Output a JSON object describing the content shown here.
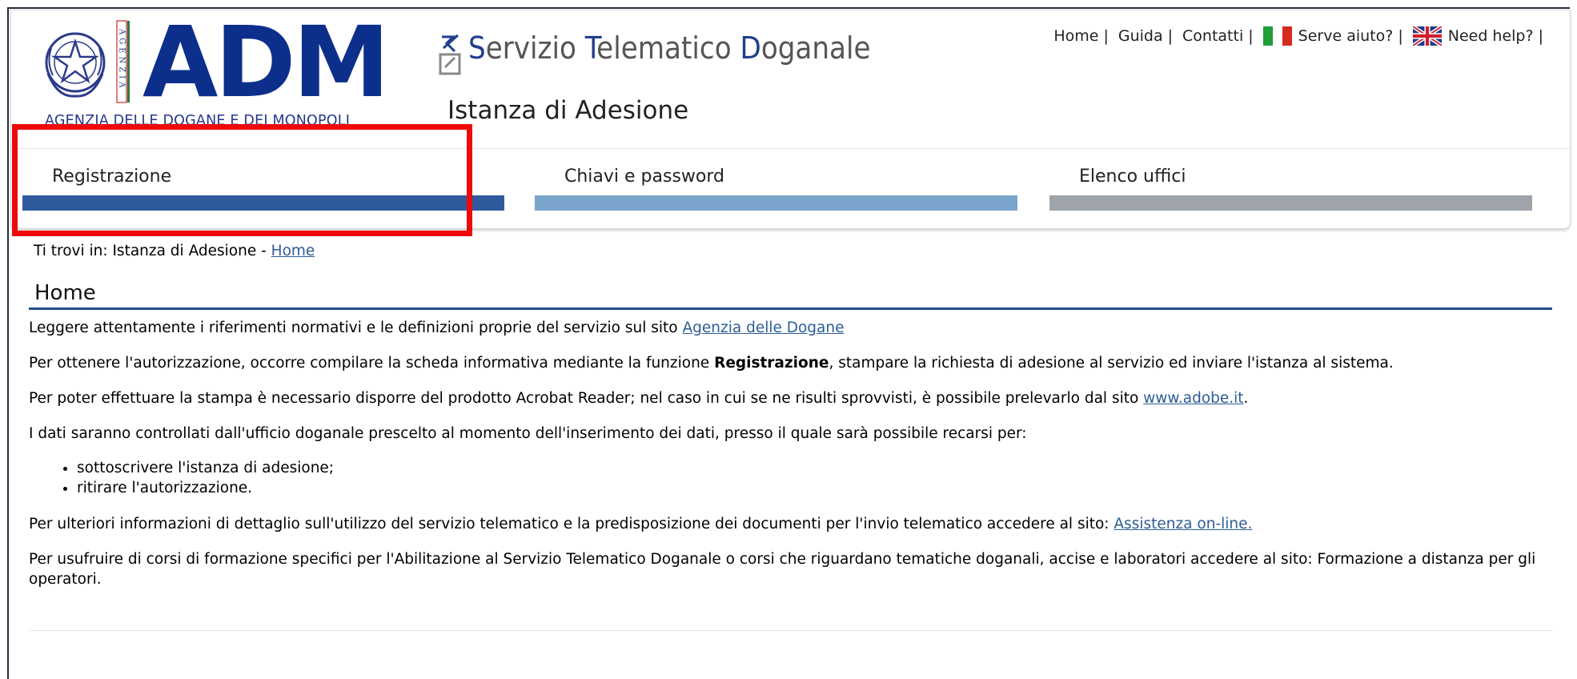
{
  "logo": {
    "acronym": "ADM",
    "vertical_text": "AGENZIA",
    "caption": "AGENZIA DELLE DOGANE E DEI MONOPOLI",
    "brand_color": "#0c2f8c"
  },
  "service": {
    "title_parts": [
      {
        "cap": "S",
        "rest": "ervizio "
      },
      {
        "cap": "T",
        "rest": "elematico "
      },
      {
        "cap": "D",
        "rest": "oganale"
      }
    ],
    "subtitle": "Istanza di Adesione"
  },
  "top_links": {
    "home": "Home",
    "guida": "Guida",
    "contatti": "Contatti",
    "serve_aiuto": "Serve aiuto?",
    "need_help": "Need help?",
    "separator": "|"
  },
  "tabs": [
    {
      "label": "Registrazione",
      "color": "#2f5a9e"
    },
    {
      "label": "Chiavi e password",
      "color": "#7aa4cc"
    },
    {
      "label": "Elenco uffici",
      "color": "#9ea4aa"
    }
  ],
  "breadcrumb": {
    "prefix": "Ti trovi in: Istanza di Adesione - ",
    "link": "Home"
  },
  "page": {
    "title": "Home",
    "p1_text": "Leggere attentamente i riferimenti normativi e le definizioni proprie del servizio sul sito ",
    "p1_link": "Agenzia delle Dogane",
    "p2_pre": "Per ottenere l'autorizzazione, occorre compilare la scheda informativa mediante la funzione ",
    "p2_bold": "Registrazione",
    "p2_post": ", stampare la richiesta di adesione al servizio ed inviare l'istanza al sistema.",
    "p3_text": "Per poter effettuare la stampa è necessario disporre del prodotto Acrobat Reader; nel caso in cui se ne risulti sprovvisti, è possibile prelevarlo dal sito ",
    "p3_link": "www.adobe.it",
    "p3_post": ".",
    "p4_text": "I dati saranno controllati dall'ufficio doganale prescelto al momento dell'inserimento dei dati, presso il quale sarà possibile recarsi per:",
    "list": [
      "sottoscrivere l'istanza di adesione;",
      "ritirare l'autorizzazione."
    ],
    "p5_text": "Per ulteriori informazioni di dettaglio sull'utilizzo del servizio telematico e la predisposizione dei documenti per l'invio telematico accedere al sito: ",
    "p5_link": "Assistenza on-line.",
    "p6_text": "Per usufruire di corsi di formazione specifici per l'Abilitazione al Servizio Telematico Doganale o corsi che riguardano tematiche doganali, accise e laboratori accedere al sito: Formazione a distanza per gli operatori."
  }
}
